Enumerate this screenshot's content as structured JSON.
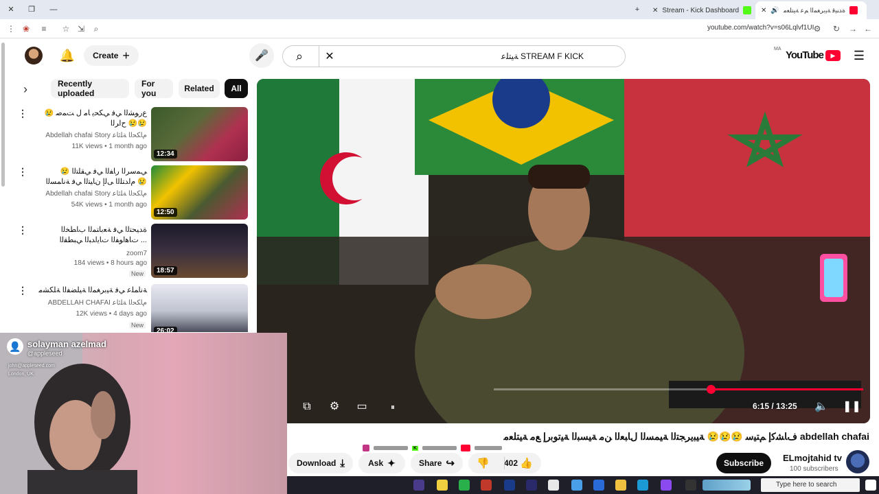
{
  "browser": {
    "tabs": [
      {
        "label": "ﺓﺪﻨﻴﻗ ﺔﻴﺑﺮﻐﻤﻟﺍ ﻢﻋ ﺔﻴﺘﻠﻌﻣ",
        "active": true
      },
      {
        "label": "Stream - Kick Dashboard",
        "active": false
      }
    ],
    "url": "youtube.com/watch?v=s06Lqlvf1UI"
  },
  "youtube": {
    "logo_text": "YouTube",
    "logo_region": "MA",
    "search_query": "ﺔﻴﺘﻠﻋ STREAM F KICK",
    "create_label": "Create"
  },
  "chips": [
    "All",
    "Related",
    "For you",
    "Recently uploaded"
  ],
  "related": [
    {
      "title": "😢 ﻉﺭﻮﺸﻟﺍ ﻲﻓ ﻲﻜﺤﻳ ﺎﻣ ﻝ ﺖﻤﺻ ﺡﺍﺮﻟﺍ 😢😢",
      "channel": "Abdellah chafai Story ﻡﺎﻜﺤﻟﺍ ﺔﻠﺋﺎﻋ",
      "meta": "11K views • 1 month ago",
      "duration": "12:34",
      "new": false
    },
    {
      "title": "😢 ﻲﻤﺳﺮﻟﺍ ﺭﺎﻔﻟﺍ ﻲﻓ ﻲﻘﻠﺘﻟﺍ ﻡﺍﺪﺘﻠﻟﺍ ﻰﻟﺇ ﻥﺎﻴﺘﻟﺍ ﻲﻓ ﺔﻧﺎﻤﺴﻟﺍ 😢",
      "channel": "Abdellah chafai Story ﻡﺎﻜﺤﻟﺍ ﺔﻠﺋﺎﻋ",
      "meta": "54K views • 1 month ago",
      "duration": "12:50",
      "new": false
    },
    {
      "title": "ﺓﺪﻴﺤﺘﻟﺍ ﻲﻓ ﺔﻌﺑﺎﺘﻤﻟﺍ ﺏﺎﻄﺨﻟﺍ ﺕﺎﻫﺍﻮﻔﻟﺍ ﺕﺎﻳﺍﺪﺒﻟﺍ ﻲﺒﻄﻘﻟﺍ ...",
      "channel": "zoom7",
      "meta": "184 views • 8 hours ago",
      "duration": "18:57",
      "new": true
    },
    {
      "title": "ﺔﻧﺎﻤﻠﻋ ﻲﻓ ﺔﻴﺑﺮﻐﻤﻟﺍ ﺔﻴﻠﻀﻔﻟﺍ ﺔﻠﻜﺸﻣ",
      "channel": "ABDELLAH CHAFAI ﻡﺎﻜﺤﻟﺍ ﺔﻠﺋﺎﻋ",
      "meta": "12K views • 4 days ago",
      "duration": "26:02",
      "new": true
    }
  ],
  "player": {
    "time_current": "6:15",
    "time_total": "13:25",
    "timecode": "6:15 / 13:25",
    "progress": 0.47
  },
  "video": {
    "title": "ﻑﺎﺸﻛﺇ ﻢﺘﻴﺳ 😢😢😢 ﺔﻴﺒﻳﺮﺠﺘﻟﺍ ﺔﻴﻤﺴﻟﺍ ﻝﺎﺒﻌﻟﺍ ﻦﻣ ﺔﻴﺴﺒﻟﺍ ﺔﻴﺗﻮﺑﺭﺇ ﻊﻣ ﺔﻴﺘﻠﻌﻣ abdellah chafai",
    "channel_name": "ELmojtahid tv",
    "subscribers": "100 subscribers",
    "subscribe_label": "Subscribe",
    "likes": "402",
    "share_label": "Share",
    "ask_label": "Ask",
    "download_label": "Download"
  },
  "webcam": {
    "name": "solayman azelmad",
    "handle": "@appleseed",
    "email": "john@appleseed.com",
    "location": "London, UK"
  },
  "taskbar": {
    "search_placeholder": "Type here to search"
  },
  "colors": {
    "accent": "#ff0033",
    "chip_active": "#0f0f0f",
    "taskbar": "#1f1f2a"
  }
}
